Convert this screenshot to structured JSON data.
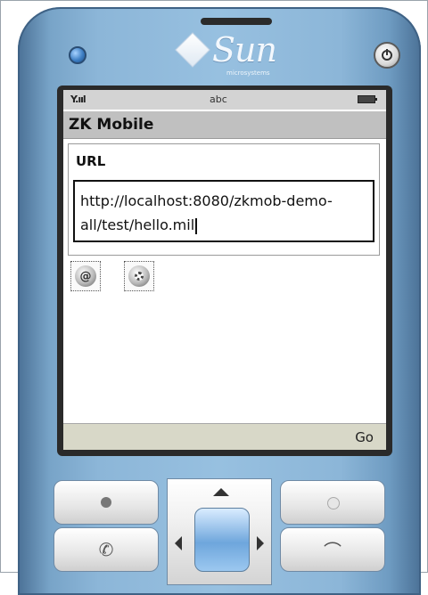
{
  "device": {
    "brand": "Sun",
    "brand_sub": "microsystems"
  },
  "status_bar": {
    "signal": "Y.ııl",
    "input_mode": "abc"
  },
  "app": {
    "title": "ZK Mobile"
  },
  "form": {
    "url_label": "URL",
    "url_line1": "http://localhost:8080/zkmob-demo-",
    "url_line2": "all/test/hello.mil"
  },
  "icons": {
    "at_icon_glyph": "@",
    "gear_icon": "gear-icon"
  },
  "softkeys": {
    "right": "Go"
  },
  "keypad": {
    "call_glyph": "✆",
    "end_glyph": "⌒"
  },
  "colors": {
    "phone_body": "#8cb6d8",
    "title_bar": "#c0c0c0",
    "status_bar": "#d3d3d3",
    "softkey_bar": "#d8d8c8"
  }
}
